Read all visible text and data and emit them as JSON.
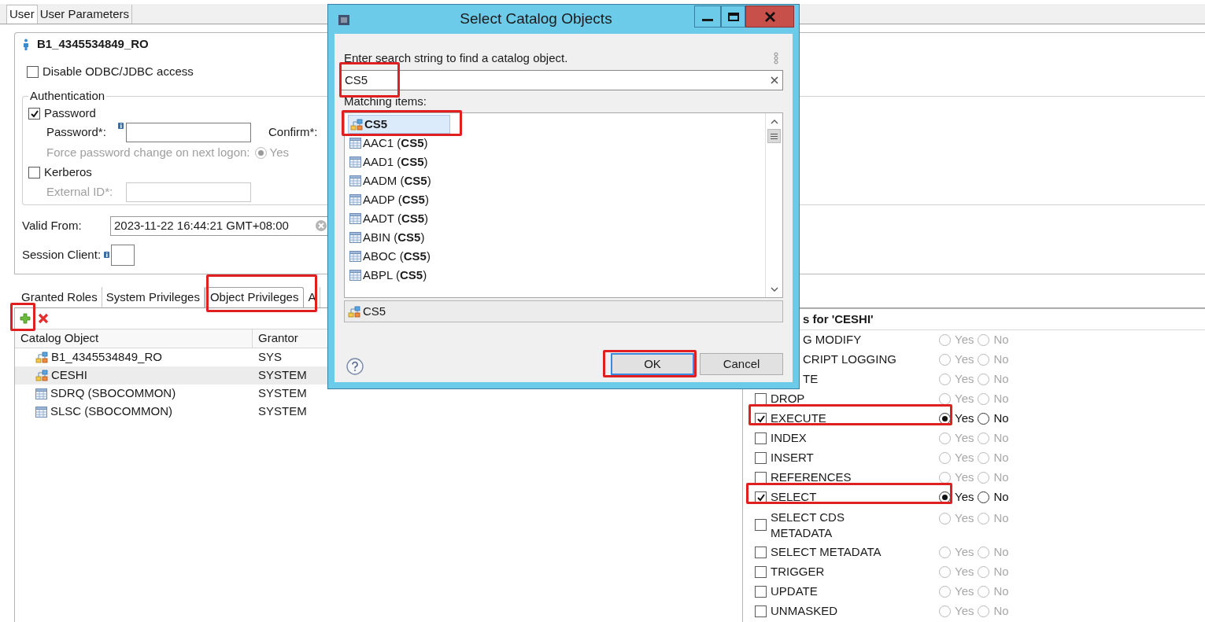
{
  "tabs": [
    {
      "label": "User",
      "selected": true
    },
    {
      "label": "User Parameters",
      "selected": false
    }
  ],
  "user": {
    "name": "B1_4345534849_RO"
  },
  "disable_access": {
    "label": "Disable ODBC/JDBC access",
    "checked": false
  },
  "authentication": {
    "title": "Authentication",
    "password": {
      "label": "Password",
      "checked": true
    },
    "password_field": {
      "label": "Password*:"
    },
    "confirm_label": "Confirm*:",
    "force_change": {
      "label": "Force password change on next logon:",
      "option": "Yes",
      "selected": true,
      "disabled": true
    },
    "kerberos": {
      "label": "Kerberos",
      "checked": false
    },
    "external_id": {
      "label": "External ID*:"
    }
  },
  "valid_from": {
    "label": "Valid From:",
    "value": "2023-11-22 16:44:21 GMT+08:00"
  },
  "session_client": {
    "label": "Session Client:"
  },
  "privilege_tabs": [
    {
      "label": "Granted Roles",
      "selected": false
    },
    {
      "label": "System Privileges",
      "selected": false
    },
    {
      "label": "Object Privileges",
      "selected": true
    },
    {
      "label": "A",
      "selected": false
    }
  ],
  "table": {
    "columns": [
      "Catalog Object",
      "Grantor"
    ],
    "rows": [
      {
        "kind": "schema",
        "object": "B1_4345534849_RO",
        "grantor": "SYS",
        "selected": false
      },
      {
        "kind": "schema",
        "object": "CESHI",
        "grantor": "SYSTEM",
        "selected": true
      },
      {
        "kind": "table",
        "object": "SDRQ (SBOCOMMON)",
        "grantor": "SYSTEM",
        "selected": false
      },
      {
        "kind": "table",
        "object": "SLSC (SBOCOMMON)",
        "grantor": "SYSTEM",
        "selected": false
      }
    ]
  },
  "privileges_panel": {
    "title": "s for 'CESHI'",
    "rows": [
      {
        "kind": "partial",
        "label": "G MODIFY",
        "disabled": true,
        "yes": "Yes",
        "no": "No",
        "yes_selected": false,
        "no_selected": false
      },
      {
        "kind": "partial",
        "label": "CRIPT LOGGING",
        "disabled": true,
        "yes": "Yes",
        "no": "No",
        "yes_selected": false,
        "no_selected": false
      },
      {
        "kind": "partial",
        "label": "TE",
        "disabled": true,
        "yes": "Yes",
        "no": "No",
        "yes_selected": false,
        "no_selected": false
      },
      {
        "kind": "full",
        "label": "DROP",
        "checked": false,
        "disabled": true,
        "yes": "Yes",
        "no": "No",
        "yes_selected": false,
        "no_selected": false
      },
      {
        "kind": "full",
        "label": "EXECUTE",
        "checked": true,
        "disabled": false,
        "yes": "Yes",
        "no": "No",
        "yes_selected": true,
        "no_selected": false
      },
      {
        "kind": "full",
        "label": "INDEX",
        "checked": false,
        "disabled": true,
        "yes": "Yes",
        "no": "No",
        "yes_selected": false,
        "no_selected": false
      },
      {
        "kind": "full",
        "label": "INSERT",
        "checked": false,
        "disabled": true,
        "yes": "Yes",
        "no": "No",
        "yes_selected": false,
        "no_selected": false
      },
      {
        "kind": "full",
        "label": "REFERENCES",
        "checked": false,
        "disabled": true,
        "yes": "Yes",
        "no": "No",
        "yes_selected": false,
        "no_selected": false
      },
      {
        "kind": "full",
        "label": "SELECT",
        "checked": true,
        "disabled": false,
        "yes": "Yes",
        "no": "No",
        "yes_selected": true,
        "no_selected": false
      },
      {
        "kind": "full",
        "label": "SELECT CDS METADATA",
        "checked": false,
        "disabled": true,
        "yes": "Yes",
        "no": "No",
        "yes_selected": false,
        "no_selected": false
      },
      {
        "kind": "full",
        "label": "SELECT METADATA",
        "checked": false,
        "disabled": true,
        "yes": "Yes",
        "no": "No",
        "yes_selected": false,
        "no_selected": false
      },
      {
        "kind": "full",
        "label": "TRIGGER",
        "checked": false,
        "disabled": true,
        "yes": "Yes",
        "no": "No",
        "yes_selected": false,
        "no_selected": false
      },
      {
        "kind": "full",
        "label": "UPDATE",
        "checked": false,
        "disabled": true,
        "yes": "Yes",
        "no": "No",
        "yes_selected": false,
        "no_selected": false
      },
      {
        "kind": "full",
        "label": "UNMASKED",
        "checked": false,
        "disabled": true,
        "yes": "Yes",
        "no": "No",
        "yes_selected": false,
        "no_selected": false
      }
    ]
  },
  "dialog": {
    "title": "Select Catalog Objects",
    "prompt": "Enter search string to find a catalog object.",
    "search": {
      "value": "CS5"
    },
    "list_label": "Matching items:",
    "items": [
      {
        "kind": "schema",
        "name": "CS5",
        "selected": true
      },
      {
        "kind": "table",
        "name": "AAC1 (**CS5**)",
        "selected": false
      },
      {
        "kind": "table",
        "name": "AAD1 (**CS5**)",
        "selected": false
      },
      {
        "kind": "table",
        "name": "AADM (**CS5**)",
        "selected": false
      },
      {
        "kind": "table",
        "name": "AADP (**CS5**)",
        "selected": false
      },
      {
        "kind": "table",
        "name": "AADT (**CS5**)",
        "selected": false
      },
      {
        "kind": "table",
        "name": "ABIN (**CS5**)",
        "selected": false
      },
      {
        "kind": "table",
        "name": "ABOC (**CS5**)",
        "selected": false
      },
      {
        "kind": "table",
        "name": "ABPL (**CS5**)",
        "selected": false
      }
    ],
    "status": {
      "kind": "schema",
      "text": "CS5"
    },
    "buttons": [
      {
        "label": "OK",
        "default": true
      },
      {
        "label": "Cancel",
        "default": false
      }
    ]
  }
}
